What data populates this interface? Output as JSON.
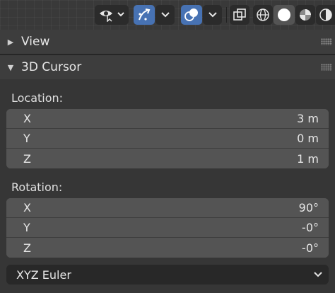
{
  "panels": {
    "view": {
      "title": "View",
      "collapsed": true
    },
    "cursor": {
      "title": "3D Cursor",
      "location_label": "Location:",
      "location": [
        {
          "axis": "X",
          "value": "3 m"
        },
        {
          "axis": "Y",
          "value": "0 m"
        },
        {
          "axis": "Z",
          "value": "1 m"
        }
      ],
      "rotation_label": "Rotation:",
      "rotation": [
        {
          "axis": "X",
          "value": "90°"
        },
        {
          "axis": "Y",
          "value": "-0°"
        },
        {
          "axis": "Z",
          "value": "-0°"
        }
      ],
      "rotation_mode": "XYZ Euler"
    }
  },
  "colors": {
    "accent": "#4772b3",
    "panel": "#3d3d3d",
    "field": "#545454"
  }
}
